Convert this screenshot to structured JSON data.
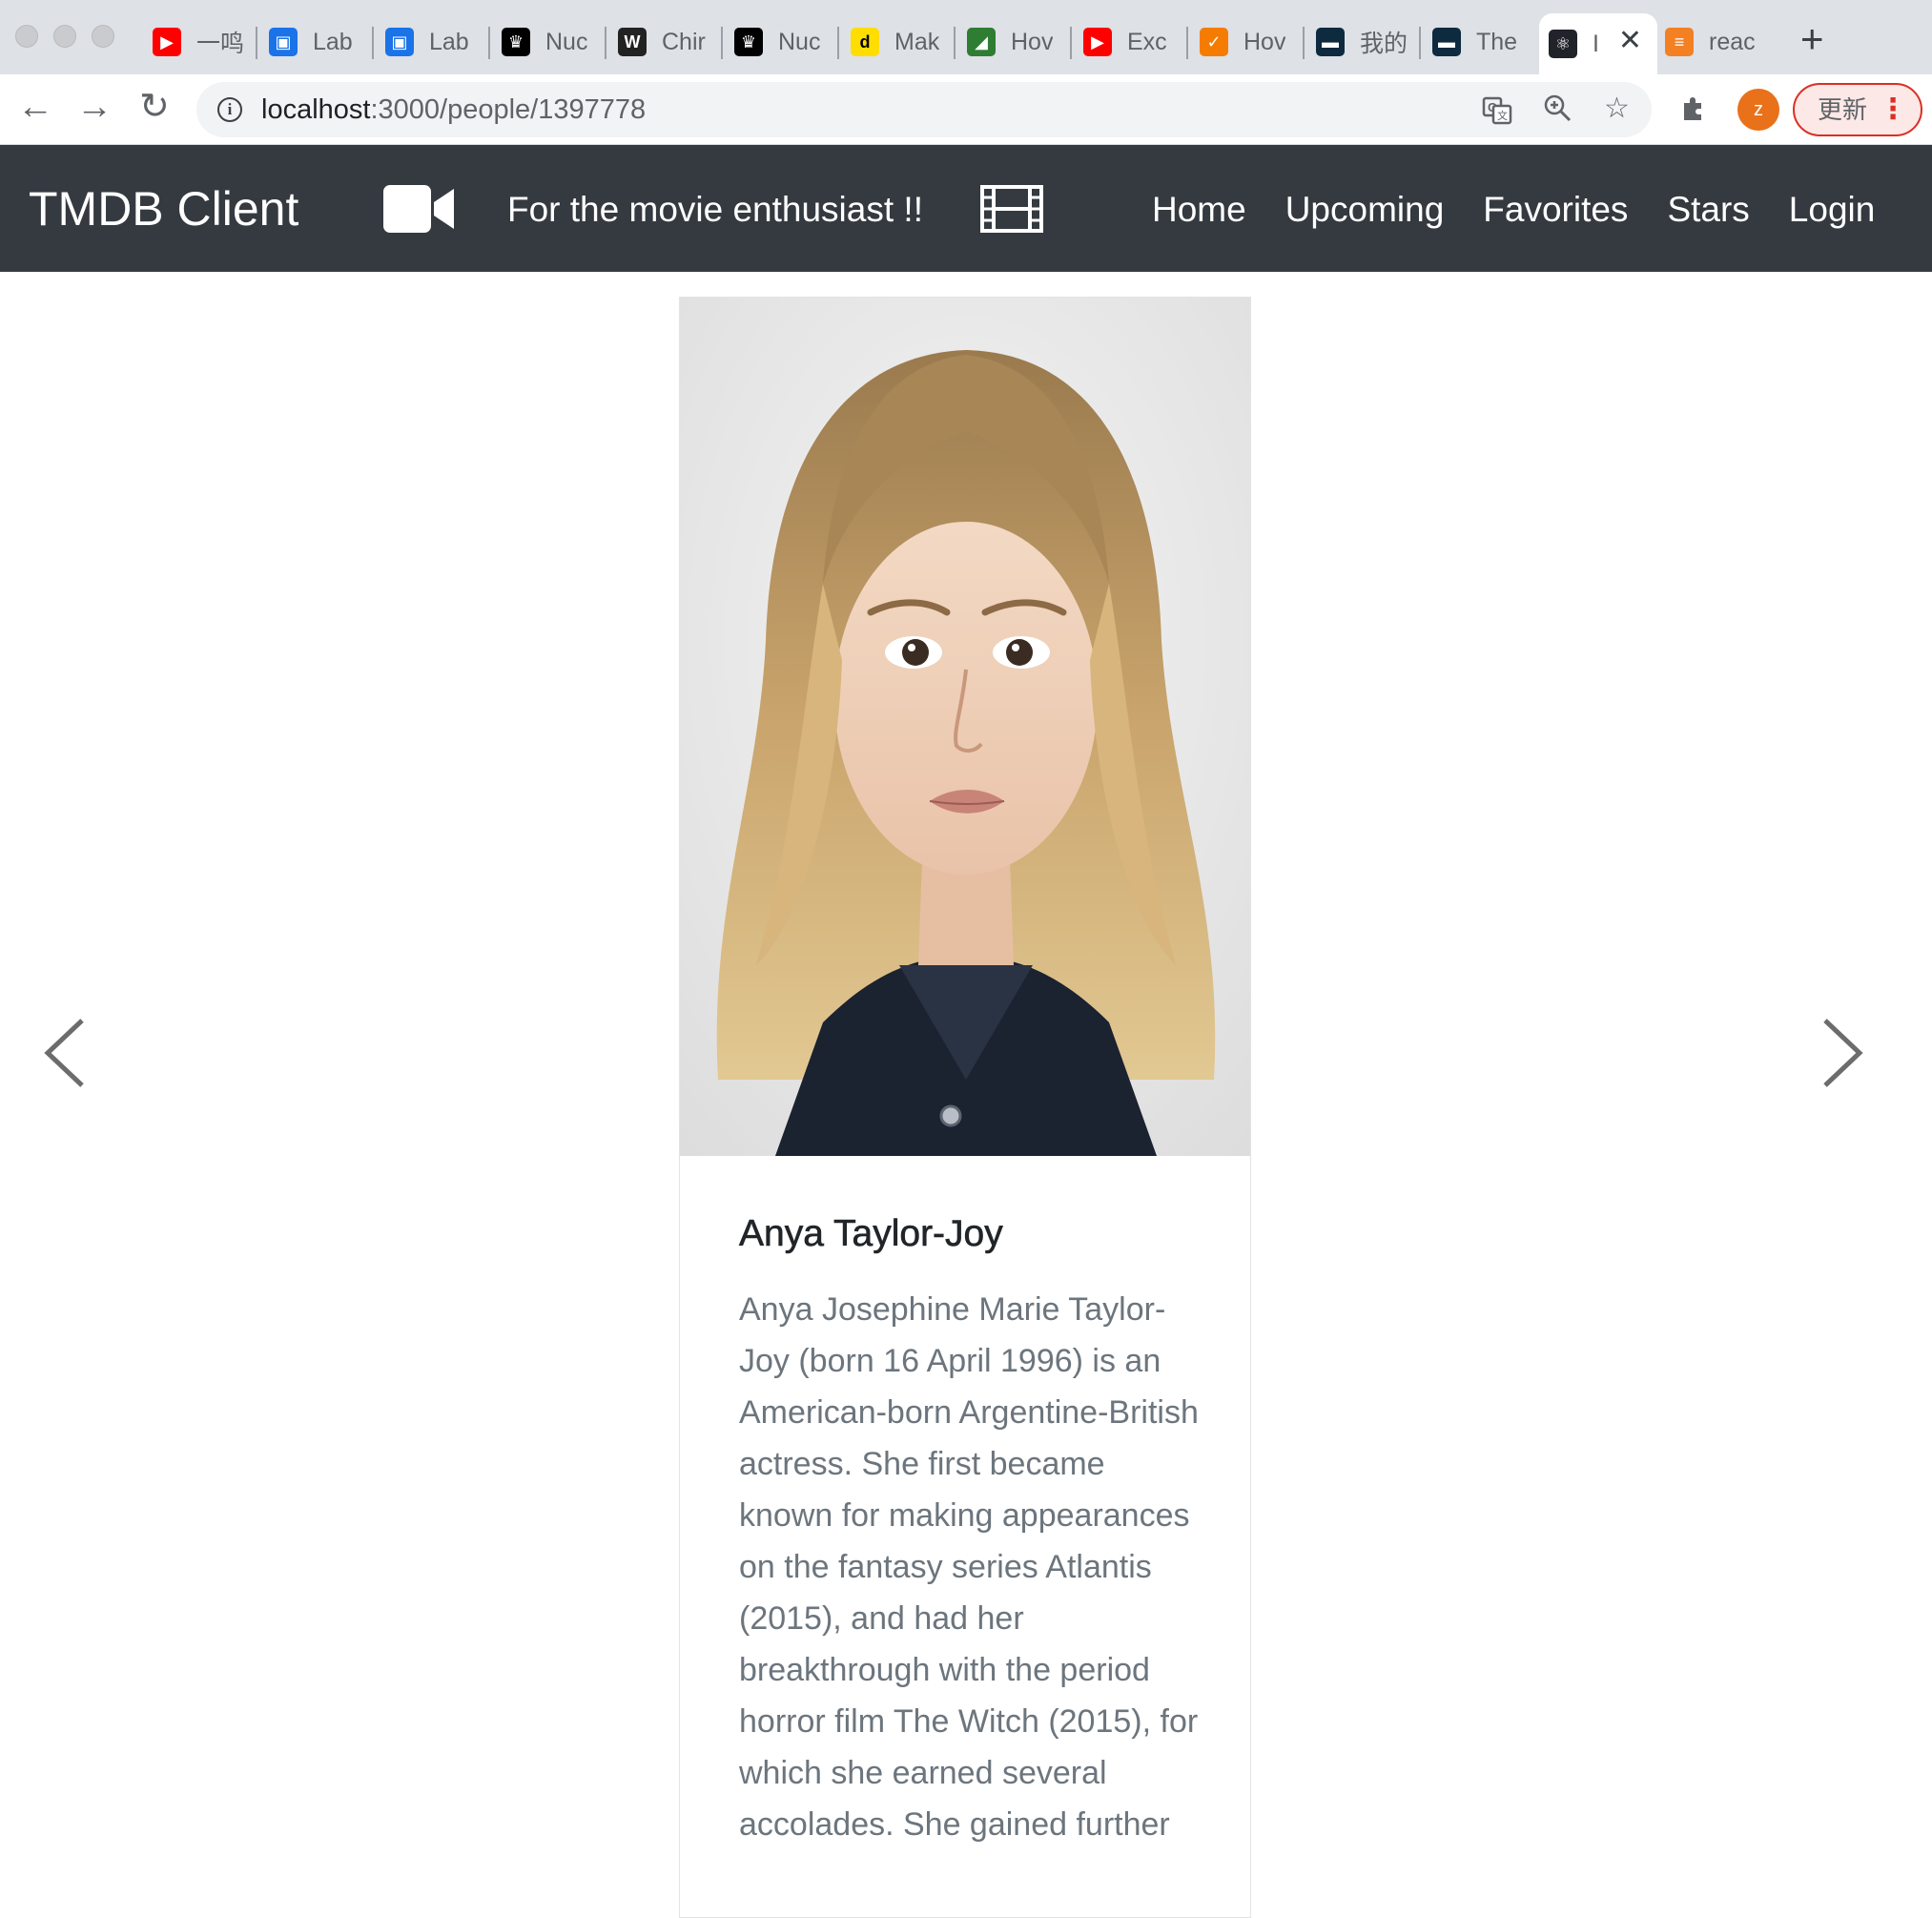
{
  "browser": {
    "tabs": [
      {
        "title": "一鸣",
        "icon": "youtube-icon",
        "color": "#ff0000"
      },
      {
        "title": "Lab",
        "icon": "classroom-icon",
        "color": "#1a73e8"
      },
      {
        "title": "Lab",
        "icon": "classroom-icon",
        "color": "#1a73e8"
      },
      {
        "title": "Nuc",
        "icon": "crown-icon",
        "color": "#000000"
      },
      {
        "title": "Chir",
        "icon": "w-logo-icon",
        "color": "#222222"
      },
      {
        "title": "Nuc",
        "icon": "crown-icon",
        "color": "#000000"
      },
      {
        "title": "Mak",
        "icon": "d-logo-icon",
        "color": "#ffdd00"
      },
      {
        "title": "Hov",
        "icon": "green-leaf-icon",
        "color": "#2e7d32"
      },
      {
        "title": "Exc",
        "icon": "youtube-icon",
        "color": "#ff0000"
      },
      {
        "title": "Hov",
        "icon": "orange-check-icon",
        "color": "#f57c00"
      },
      {
        "title": "我的",
        "icon": "dark-pill-icon",
        "color": "#0d2a3f"
      },
      {
        "title": "The",
        "icon": "dark-pill-icon",
        "color": "#0d2a3f"
      },
      {
        "title": "I",
        "icon": "react-icon",
        "color": "#20232a"
      },
      {
        "title": "reac",
        "icon": "stackoverflow-icon",
        "color": "#f48024"
      }
    ],
    "active_tab_index": 12,
    "new_tab_label": "+",
    "url_host": "localhost",
    "url_path": ":3000/people/1397778",
    "update_label": "更新",
    "profile_initial": "z"
  },
  "navbar": {
    "brand": "TMDB Client",
    "tagline": "For the movie enthusiast !!",
    "links": [
      "Home",
      "Upcoming",
      "Favorites",
      "Stars",
      "Login"
    ]
  },
  "person": {
    "name": "Anya Taylor-Joy",
    "biography": "Anya Josephine Marie Taylor-Joy (born 16 April 1996) is an American-born Argentine-British actress. She first became known for making appearances on the fantasy series Atlantis (2015), and had her breakthrough with the period horror film The Witch (2015), for which she earned several accolades. She gained further"
  },
  "colors": {
    "navbar_bg": "#343a40",
    "accent_profile": "#e8711a",
    "update_border": "#d93025",
    "bio_text": "#6c757d"
  }
}
